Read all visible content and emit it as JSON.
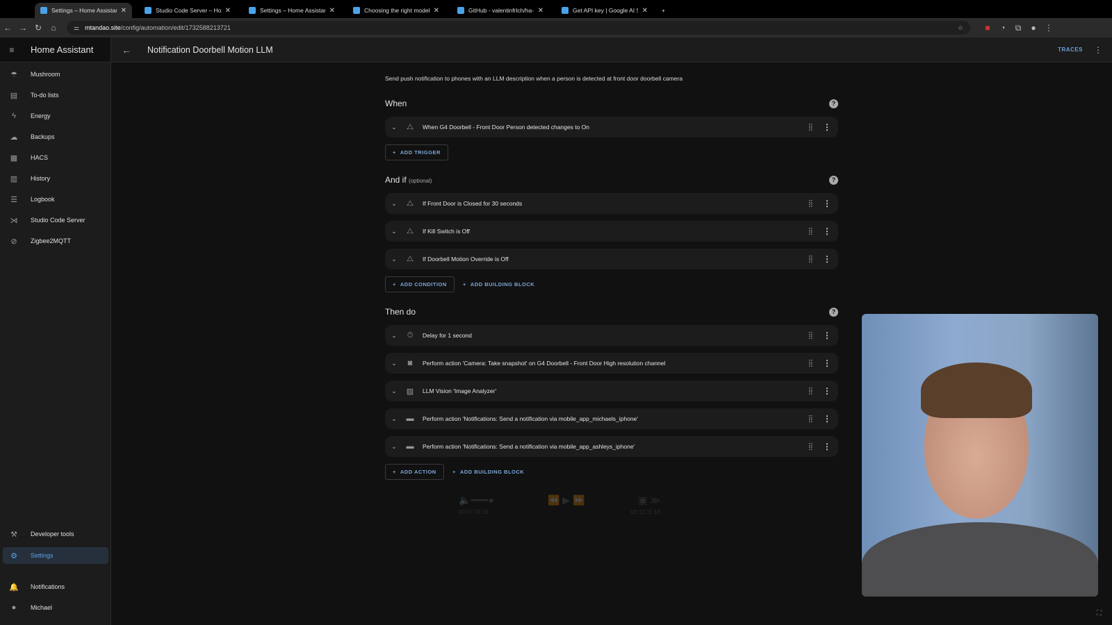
{
  "browser": {
    "tabs": [
      {
        "title": "Settings – Home Assistant",
        "active": true,
        "icon": "home-assistant-icon"
      },
      {
        "title": "Studio Code Server – Home A",
        "icon": "home-assistant-icon"
      },
      {
        "title": "Settings – Home Assistant",
        "icon": "home-assistant-icon"
      },
      {
        "title": "Choosing the right model | LL",
        "icon": "gear-icon"
      },
      {
        "title": "GitHub - valentinfrlch/ha-llm",
        "icon": "github-icon"
      },
      {
        "title": "Get API key | Google AI Studi",
        "icon": "google-ai-studio-icon"
      }
    ],
    "new_tab": "+",
    "url_host": "mtandao.site",
    "url_path": "/config/automation/edit/1732588213721"
  },
  "sidebar": {
    "title": "Home Assistant",
    "items": [
      {
        "label": "Mushroom",
        "icon": "mushroom-icon",
        "glyph": "☂"
      },
      {
        "label": "To-do lists",
        "icon": "clipboard-list-icon",
        "glyph": "▤"
      },
      {
        "label": "Energy",
        "icon": "lightning-bolt-icon",
        "glyph": "ϟ"
      },
      {
        "label": "Backups",
        "icon": "cloud-icon",
        "glyph": "☁"
      },
      {
        "label": "HACS",
        "icon": "hacs-icon",
        "glyph": "▦"
      },
      {
        "label": "History",
        "icon": "chart-box-icon",
        "glyph": "▥"
      },
      {
        "label": "Logbook",
        "icon": "format-list-icon",
        "glyph": "☰"
      },
      {
        "label": "Studio Code Server",
        "icon": "vscode-icon",
        "glyph": "⋊"
      },
      {
        "label": "Zigbee2MQTT",
        "icon": "zigbee-icon",
        "glyph": "⊘"
      }
    ],
    "bottom": [
      {
        "label": "Developer tools",
        "icon": "hammer-icon",
        "glyph": "⚒"
      },
      {
        "label": "Settings",
        "icon": "gear-icon",
        "glyph": "⚙",
        "selected": true
      },
      {
        "label": "Notifications",
        "icon": "bell-icon",
        "glyph": "🔔"
      },
      {
        "label": "Michael",
        "icon": "avatar",
        "glyph": "●"
      }
    ]
  },
  "header": {
    "title": "Notification Doorbell Motion LLM",
    "traces": "TRACES"
  },
  "automation": {
    "description": "Send push notification to phones with an LLM description when a person is detected at front door doorbell camera",
    "when": {
      "title": "When",
      "rows": [
        {
          "text": "When G4 Doorbell - Front Door Person detected changes to On",
          "icon": "trigger-icon",
          "glyph": "⧍"
        }
      ],
      "add": "ADD TRIGGER"
    },
    "and_if": {
      "title": "And if",
      "hint": "(optional)",
      "rows": [
        {
          "text": "If Front Door is Closed for 30 seconds",
          "icon": "condition-icon",
          "glyph": "⧍"
        },
        {
          "text": "If Kill Switch is Off",
          "icon": "condition-icon",
          "glyph": "⧍"
        },
        {
          "text": "If Doorbell Motion Override is Off",
          "icon": "condition-icon",
          "glyph": "⧍"
        }
      ],
      "add": "ADD CONDITION",
      "add_block": "ADD BUILDING BLOCK"
    },
    "then_do": {
      "title": "Then do",
      "rows": [
        {
          "text": "Delay for 1 second",
          "icon": "timer-icon",
          "glyph": "⏱"
        },
        {
          "text": "Perform action 'Camera: Take snapshot' on G4 Doorbell - Front Door High resolution channel",
          "icon": "camera-icon",
          "glyph": "◙"
        },
        {
          "text": "LLM Vision 'Image Analyzer'",
          "icon": "image-search-icon",
          "glyph": "▨"
        },
        {
          "text": "Perform action 'Notifications: Send a notification via mobile_app_michaels_iphone'",
          "icon": "message-icon",
          "glyph": "▬"
        },
        {
          "text": "Perform action 'Notifications: Send a notification via mobile_app_ashleys_iphone'",
          "icon": "message-icon",
          "glyph": "▬"
        }
      ],
      "add": "ADD ACTION",
      "add_block": "ADD BUILDING BLOCK"
    }
  },
  "media_overlay": {
    "elapsed": "00:07:39:16",
    "remaining": "00:12:31:18"
  }
}
